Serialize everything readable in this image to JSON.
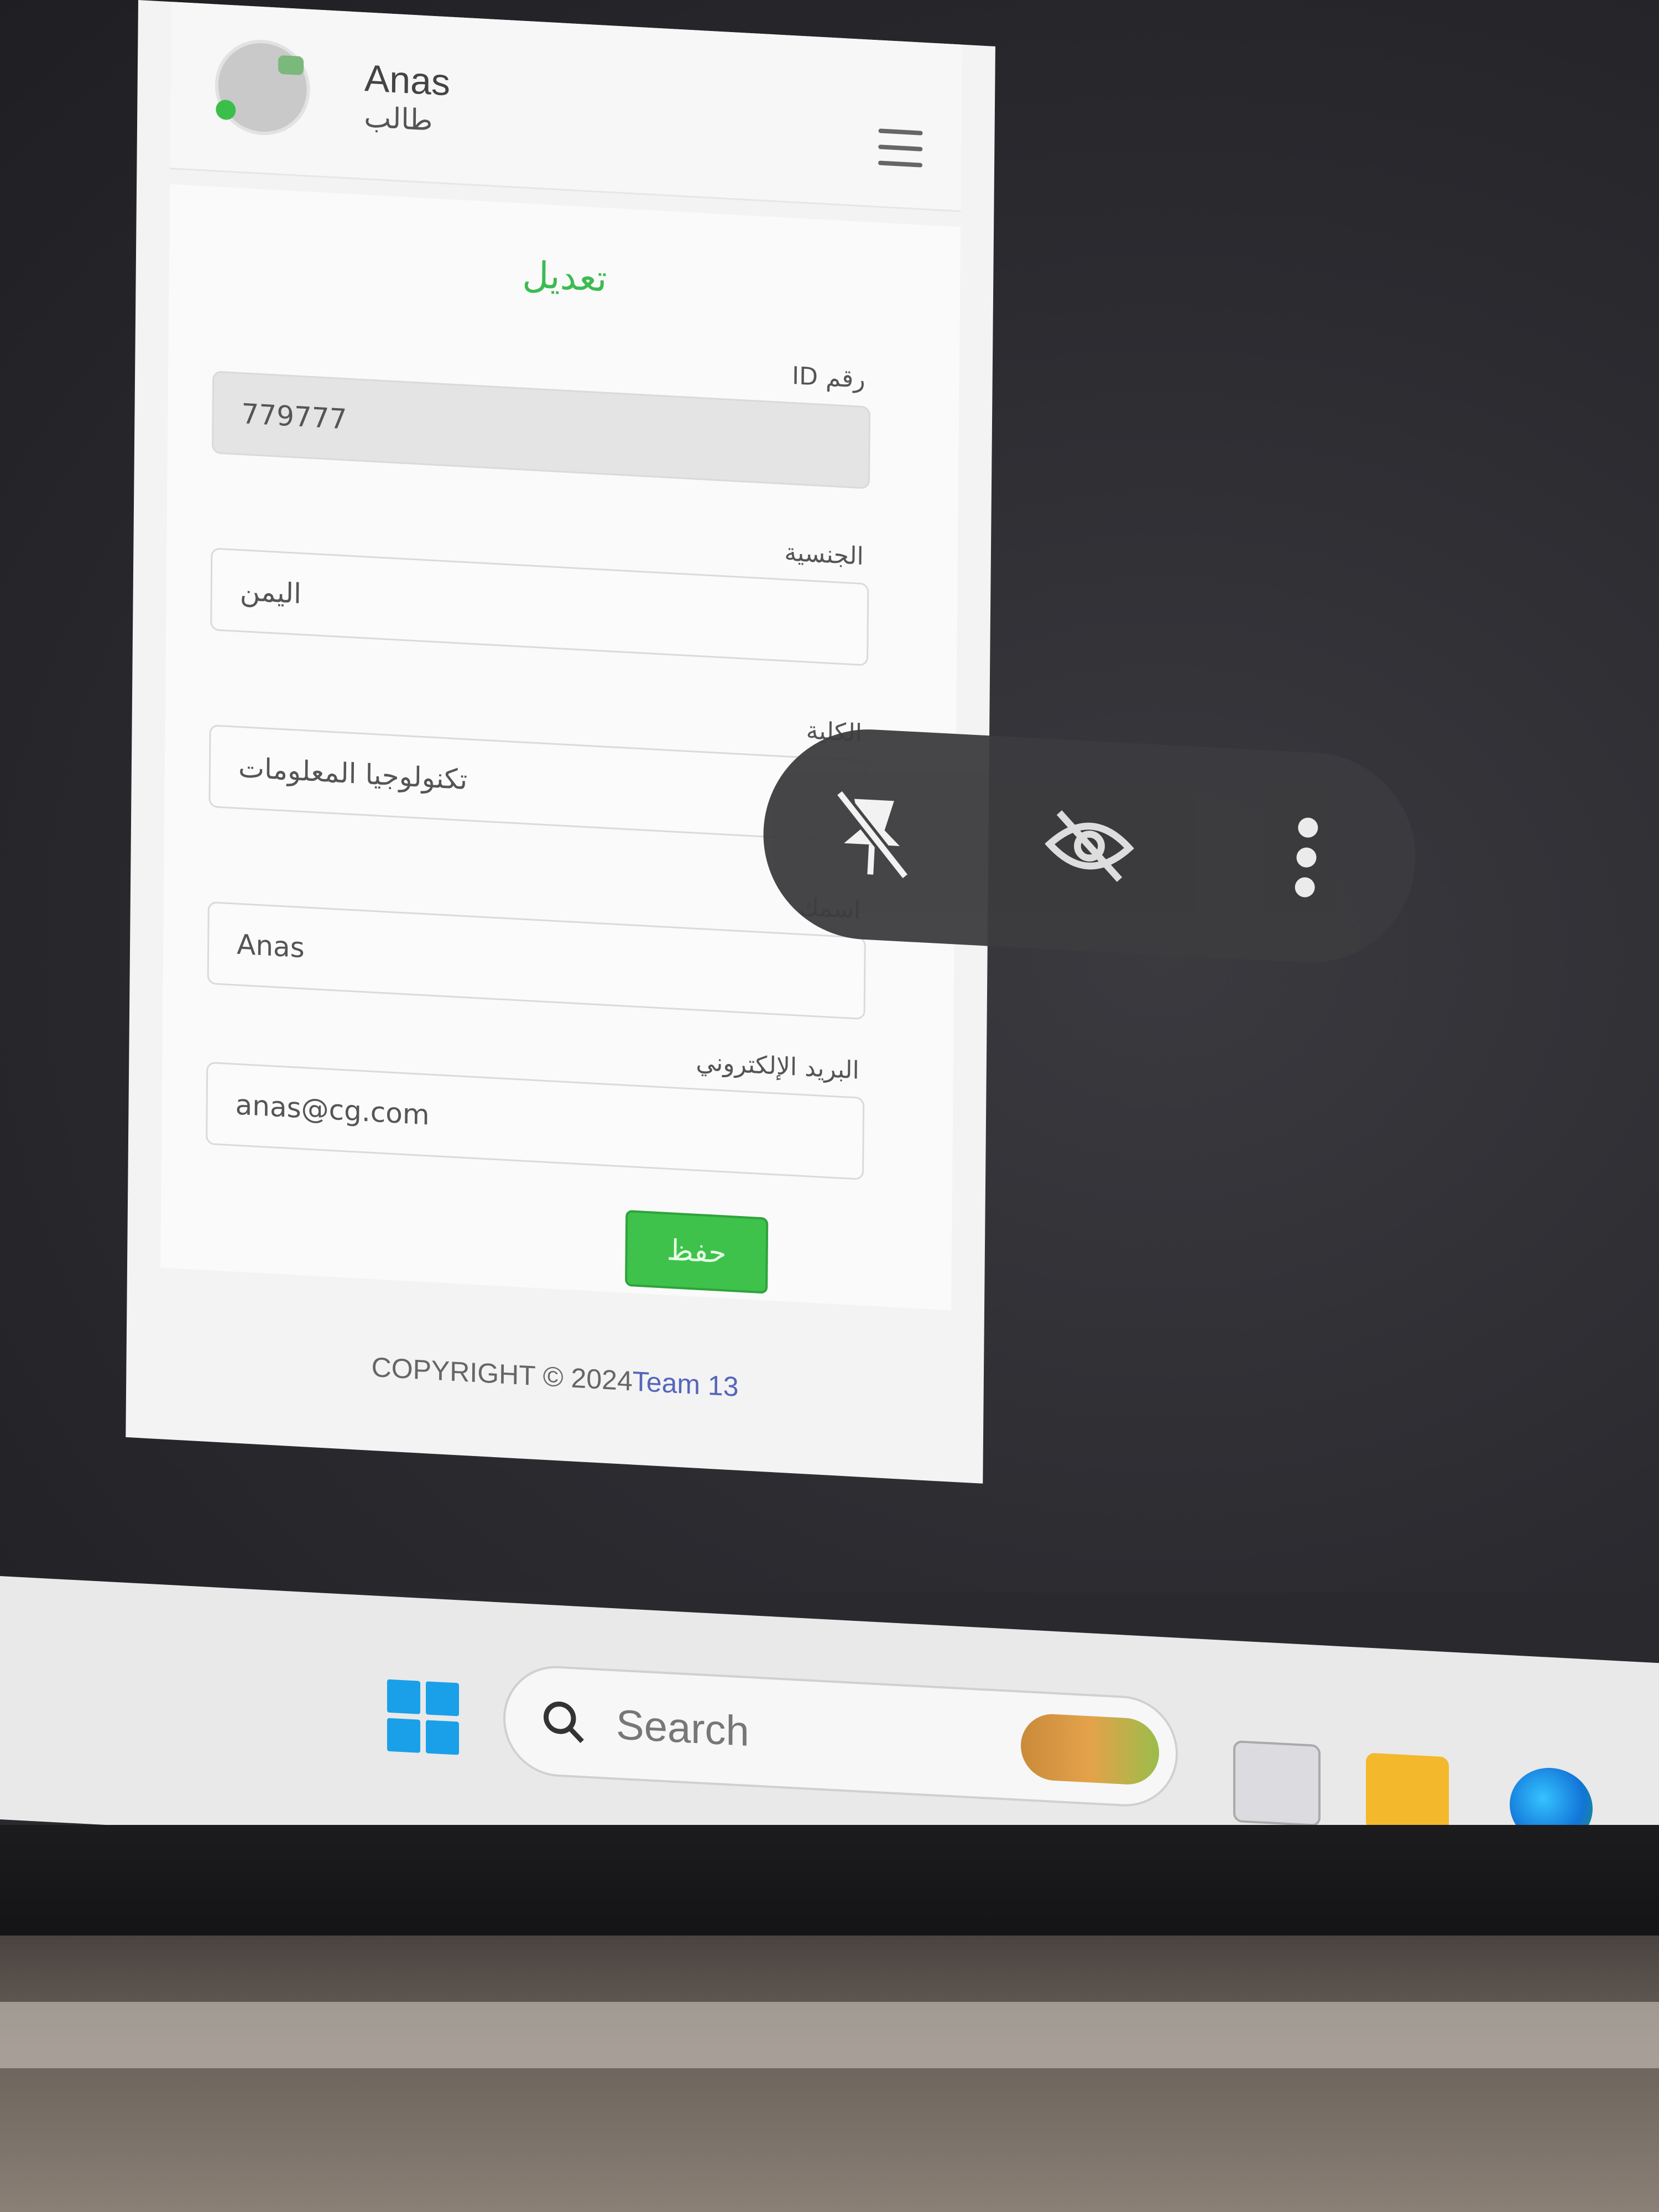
{
  "header": {
    "user_name": "Anas",
    "user_role": "طالب"
  },
  "form": {
    "title": "تعديل",
    "fields": [
      {
        "label": "رقم ID",
        "value": "779777"
      },
      {
        "label": "الجنسية",
        "value": "اليمن"
      },
      {
        "label": "الكلية",
        "value": "تكنولوجيا المعلومات"
      },
      {
        "label": "اسمك",
        "value": "Anas"
      },
      {
        "label": "البريد الإلكتروني",
        "value": "anas@cg.com"
      }
    ],
    "save_label": "حفظ"
  },
  "footer": {
    "copyright": "COPYRIGHT © 2024",
    "team": "Team 13"
  },
  "floating_toolbar": {
    "icons": [
      "unpin-icon",
      "visibility-off-icon",
      "more-vertical-icon"
    ]
  },
  "taskbar": {
    "search_placeholder": "Search"
  },
  "colors": {
    "accent_green": "#3dbb52",
    "footer_link": "#5566bb",
    "windows_blue": "#1aa0e8"
  }
}
